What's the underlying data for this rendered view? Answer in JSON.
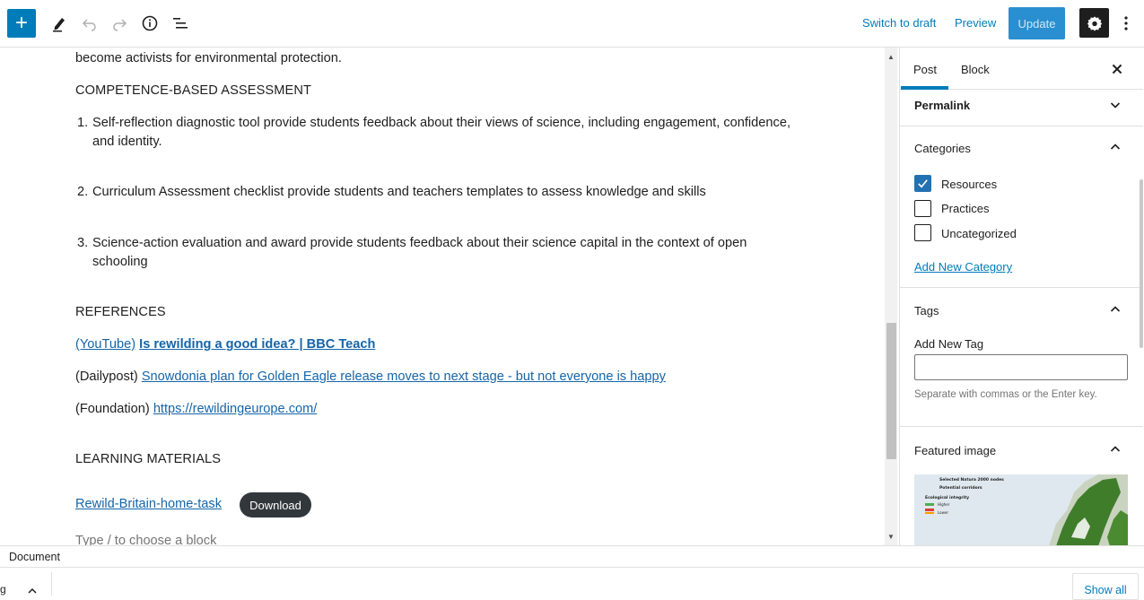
{
  "toolbar": {
    "add_block_label": "+",
    "switch_to_draft": "Switch to draft",
    "preview": "Preview",
    "update": "Update"
  },
  "content": {
    "intro_fragment": "become activists for  environmental protection.",
    "assessment_heading": "COMPETENCE-BASED ASSESSMENT",
    "assessment_items": [
      {
        "num": "1.",
        "text": "Self-reflection diagnostic tool provide students feedback about their views of science, including engagement, confidence, and identity."
      },
      {
        "num": "2.",
        "text": "Curriculum Assessment checklist provide students and teachers templates to assess knowledge and skills"
      },
      {
        "num": "3.",
        "text": "Science-action evaluation and award provide students feedback about their science capital in the context of open schooling"
      }
    ],
    "references_heading": "REFERENCES",
    "ref1_prefix": "(YouTube)",
    "ref1_link": "Is rewilding a good idea? | BBC Teach",
    "ref2_prefix": "(Dailypost)",
    "ref2_link": "Snowdonia plan for Golden Eagle release moves to next stage - but not everyone is happy",
    "ref3_prefix": "(Foundation)",
    "ref3_link": "https://rewildingeurope.com/",
    "learning_heading": "LEARNING MATERIALS",
    "file_name": "Rewild-Britain-home-task",
    "download_label": "Download",
    "block_placeholder": "Type / to choose a block"
  },
  "sidebar": {
    "tabs": [
      {
        "label": "Post"
      },
      {
        "label": "Block"
      }
    ],
    "permalink_title": "Permalink",
    "categories_title": "Categories",
    "categories": [
      {
        "label": "Resources",
        "checked": true
      },
      {
        "label": "Practices",
        "checked": false
      },
      {
        "label": "Uncategorized",
        "checked": false
      }
    ],
    "add_category": "Add New Category",
    "tags_title": "Tags",
    "add_tag_label": "Add New Tag",
    "tag_help": "Separate with commas or the Enter key.",
    "featured_title": "Featured image",
    "map_legend": [
      "Selected Natura 2000 nodes",
      "Potential corridors",
      "Ecological integrity",
      "Higher",
      "Lower"
    ]
  },
  "footer": {
    "breadcrumb": "Document",
    "show_all": "Show all",
    "left_fragment": "g"
  }
}
